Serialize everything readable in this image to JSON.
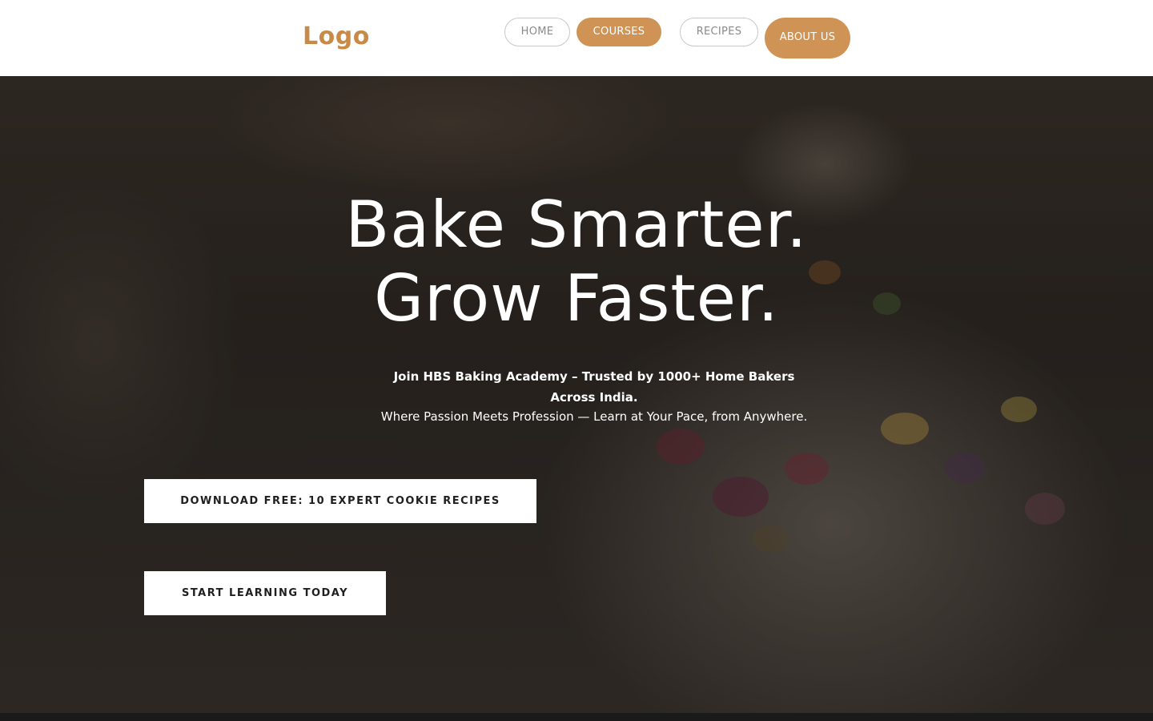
{
  "header": {
    "logo": "Logo",
    "nav": {
      "home": "HOME",
      "courses": "COURSES",
      "recipes": "RECIPES",
      "about": "ABOUT US"
    }
  },
  "hero": {
    "title_line1": "Bake Smarter.",
    "title_line2": "Grow Faster.",
    "tagline": "Join HBS Baking Academy – Trusted by 1000+ Home Bakers Across India.",
    "subline": "Where Passion Meets Profession — Learn at Your Pace, from Anywhere.",
    "cta_download": "DOWNLOAD FREE: 10 EXPERT COOKIE RECIPES",
    "cta_start": "START LEARNING TODAY"
  },
  "colors": {
    "accent": "#cf9455",
    "logo": "#c98a48",
    "header_bg": "#ffffff"
  }
}
